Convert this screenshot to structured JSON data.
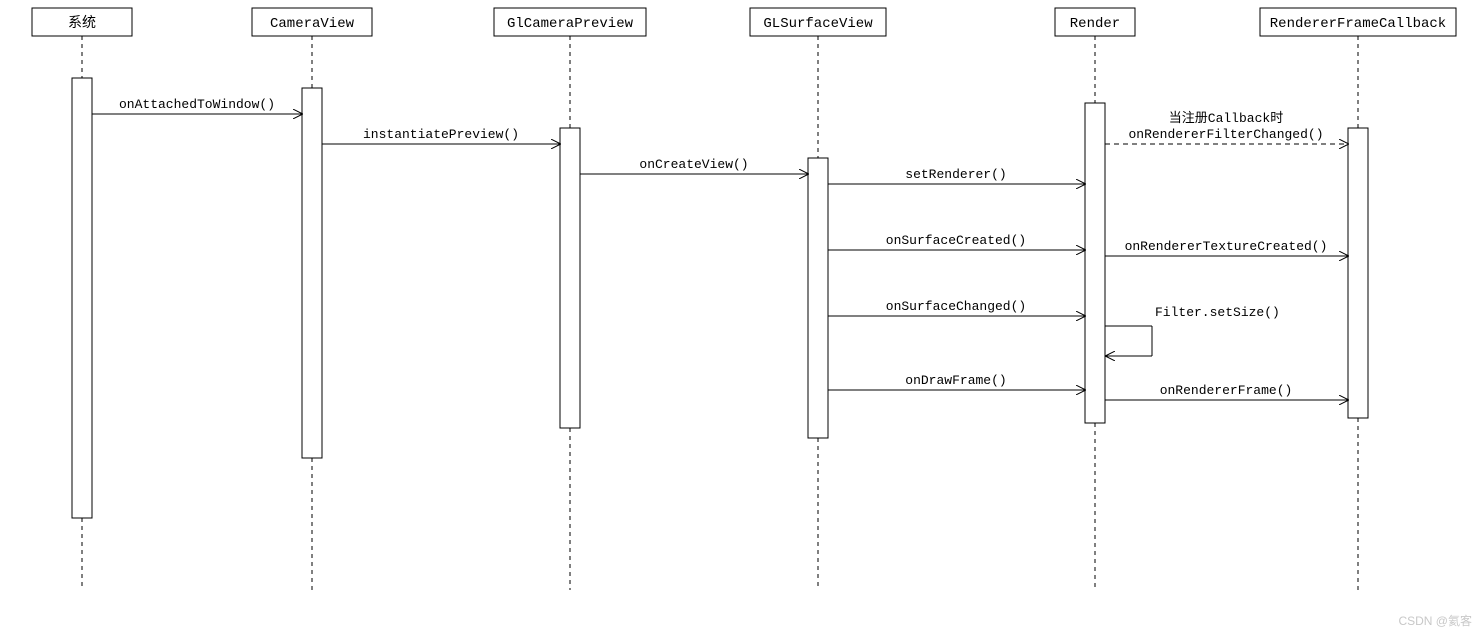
{
  "participants": {
    "p0": "系统",
    "p1": "CameraView",
    "p2": "GlCameraPreview",
    "p3": "GLSurfaceView",
    "p4": "Render",
    "p5": "RendererFrameCallback"
  },
  "messages": {
    "m0": "onAttachedToWindow()",
    "m1": "instantiatePreview()",
    "m2": "onCreateView()",
    "m3": "setRenderer()",
    "m4_1": "当注册Callback时",
    "m4_2": "onRendererFilterChanged()",
    "m5": "onSurfaceCreated()",
    "m6": "onRendererTextureCreated()",
    "m7": "onSurfaceChanged()",
    "m8": "Filter.setSize()",
    "m9": "onDrawFrame()",
    "m10": "onRendererFrame()"
  },
  "watermark": "CSDN @氦客"
}
